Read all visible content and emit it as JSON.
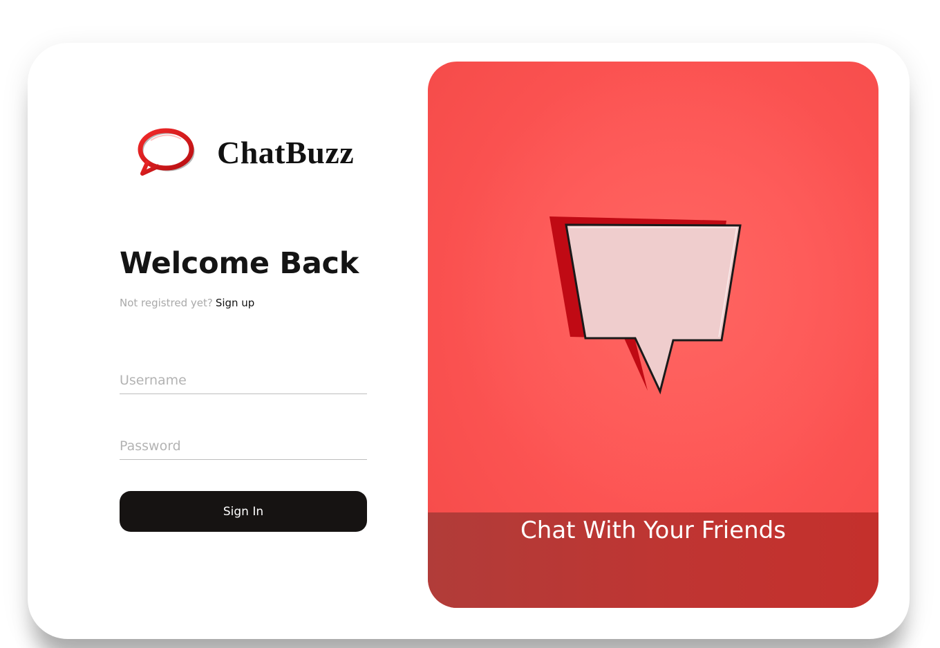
{
  "brand": {
    "name": "ChatBuzz",
    "logo_icon": "speech-bubble-logo-icon",
    "logo_color": "#d91a1a"
  },
  "login": {
    "heading": "Welcome Back",
    "signup_prompt": "Not registred yet?",
    "signup_link": "Sign up",
    "username_placeholder": "Username",
    "username_value": "",
    "password_placeholder": "Password",
    "password_value": "",
    "submit_label": "Sign In"
  },
  "hero": {
    "caption": "Chat With Your Friends",
    "image_icon": "speech-bubble-illustration-icon",
    "background_color": "#fd5554",
    "caption_band_color": "#bc3532"
  }
}
